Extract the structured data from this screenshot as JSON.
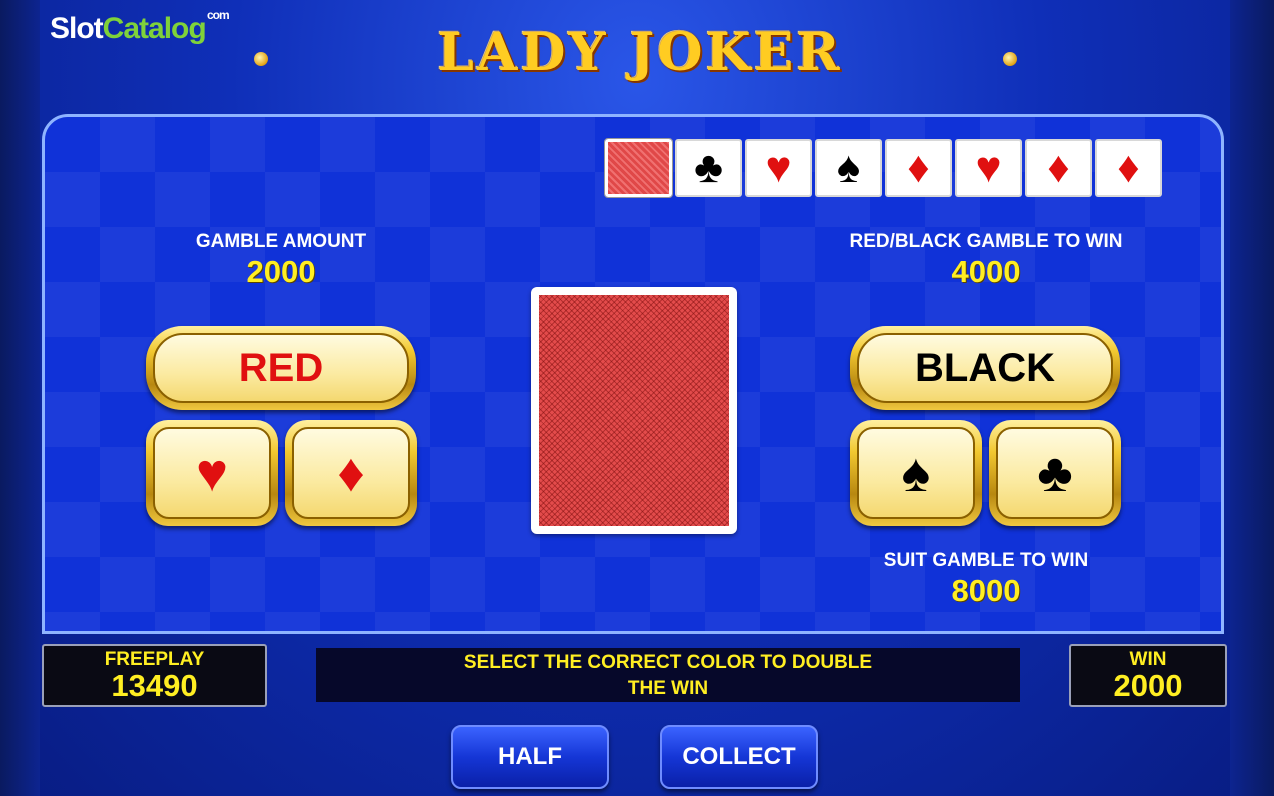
{
  "watermark": {
    "part1": "Slot",
    "part2": "Catalog",
    "suffix": "com"
  },
  "title": "LADY JOKER",
  "history_cards": [
    {
      "suit": "back",
      "glyph": "",
      "color": "back"
    },
    {
      "suit": "club",
      "glyph": "♣",
      "color": "black"
    },
    {
      "suit": "heart",
      "glyph": "♥",
      "color": "red"
    },
    {
      "suit": "spade",
      "glyph": "♠",
      "color": "black"
    },
    {
      "suit": "diamond",
      "glyph": "♦",
      "color": "red"
    },
    {
      "suit": "heart",
      "glyph": "♥",
      "color": "red"
    },
    {
      "suit": "diamond",
      "glyph": "♦",
      "color": "red"
    },
    {
      "suit": "diamond",
      "glyph": "♦",
      "color": "red"
    }
  ],
  "gamble_amount": {
    "label": "GAMBLE AMOUNT",
    "value": "2000"
  },
  "red_black_win": {
    "label": "RED/BLACK GAMBLE TO WIN",
    "value": "4000"
  },
  "suit_win": {
    "label": "SUIT GAMBLE TO WIN",
    "value": "8000"
  },
  "buttons": {
    "red": "RED",
    "black": "BLACK",
    "heart": "♥",
    "diamond": "♦",
    "spade": "♠",
    "club": "♣",
    "half": "HALF",
    "collect": "COLLECT"
  },
  "freeplay": {
    "label": "FREEPLAY",
    "value": "13490"
  },
  "win": {
    "label": "WIN",
    "value": "2000"
  },
  "message": {
    "line1": "SELECT THE CORRECT COLOR TO DOUBLE",
    "line2": "THE WIN"
  },
  "colors": {
    "red_suit": "#e01010",
    "black_suit": "#000000",
    "accent_yellow": "#ffee22",
    "panel_blue": "#1032d8"
  }
}
